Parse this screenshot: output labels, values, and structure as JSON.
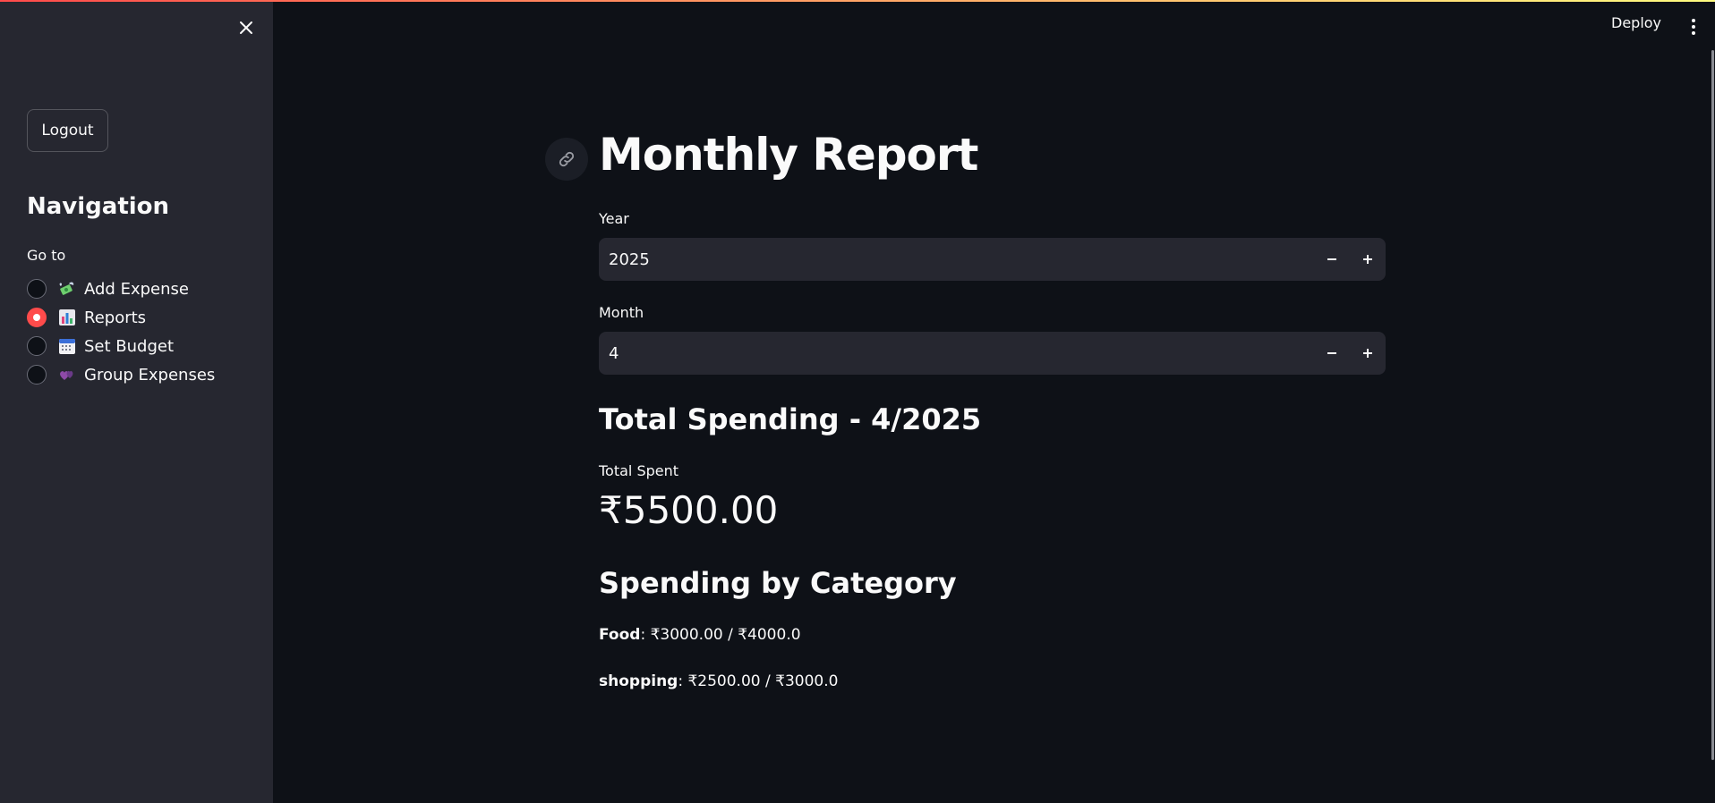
{
  "sidebar": {
    "logout_label": "Logout",
    "nav_title": "Navigation",
    "goto_label": "Go to",
    "items": [
      {
        "icon": "money-with-wings-icon",
        "label": "Add Expense",
        "selected": false
      },
      {
        "icon": "bar-chart-icon",
        "label": "Reports",
        "selected": true
      },
      {
        "icon": "calendar-icon",
        "label": "Set Budget",
        "selected": false
      },
      {
        "icon": "hearts-icon",
        "label": "Group Expenses",
        "selected": false
      }
    ]
  },
  "header": {
    "deploy_label": "Deploy"
  },
  "main": {
    "title": "Monthly Report",
    "year": {
      "label": "Year",
      "value": "2025"
    },
    "month": {
      "label": "Month",
      "value": "4"
    },
    "total_heading": "Total Spending - 4/2025",
    "metric_label": "Total Spent",
    "metric_value": "₹5500.00",
    "category_heading": "Spending by Category",
    "categories": [
      {
        "name": "Food",
        "detail": ": ₹3000.00 / ₹4000.0"
      },
      {
        "name": "shopping",
        "detail": ": ₹2500.00 / ₹3000.0"
      }
    ]
  },
  "colors": {
    "background": "#0e1117",
    "sidebar": "#262730",
    "accent": "#ff4b4b",
    "input_bg": "#262730",
    "text": "#fafafa"
  }
}
